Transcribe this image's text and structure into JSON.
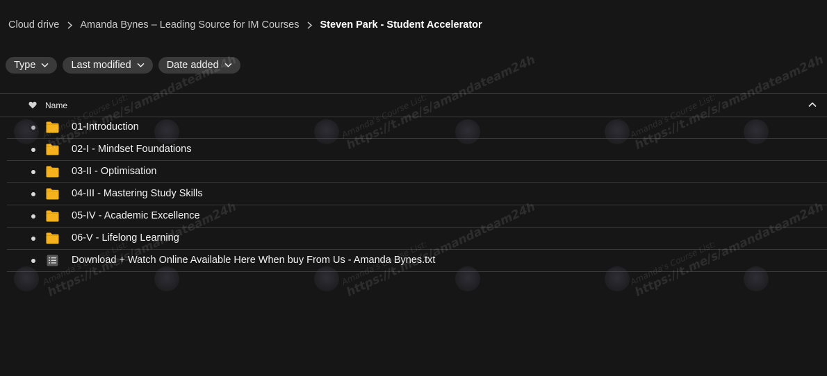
{
  "breadcrumb": {
    "items": [
      {
        "label": "Cloud drive"
      },
      {
        "label": "Amanda Bynes – Leading Source for IM Courses"
      },
      {
        "label": "Steven Park - Student Accelerator"
      }
    ]
  },
  "filters": {
    "type_label": "Type",
    "last_modified_label": "Last modified",
    "date_added_label": "Date added"
  },
  "table": {
    "name_header": "Name",
    "rows": [
      {
        "name": "01-Introduction",
        "kind": "folder"
      },
      {
        "name": "02-I - Mindset Foundations",
        "kind": "folder"
      },
      {
        "name": "03-II - Optimisation",
        "kind": "folder"
      },
      {
        "name": "04-III - Mastering Study Skills",
        "kind": "folder"
      },
      {
        "name": "05-IV - Academic Excellence",
        "kind": "folder"
      },
      {
        "name": "06-V - Lifelong Learning",
        "kind": "folder"
      },
      {
        "name": "Download + Watch Online Available Here When buy From Us - Amanda Bynes.txt",
        "kind": "text-file"
      }
    ]
  },
  "watermark": {
    "line1": "Amanda's Course List:",
    "line2": "https://t.me/s/amandateam24h"
  },
  "colors": {
    "background": "#161616",
    "folder": "#f6b21b",
    "chip": "#3a3a3a",
    "divider": "#3a3a3a"
  },
  "icons": {
    "folder": "folder-icon",
    "text_file": "text-file-icon",
    "heart": "heart-icon",
    "sort": "chevron-up-icon",
    "chip_chevron": "chevron-down-icon",
    "breadcrumb_sep": "chevron-right-icon"
  }
}
